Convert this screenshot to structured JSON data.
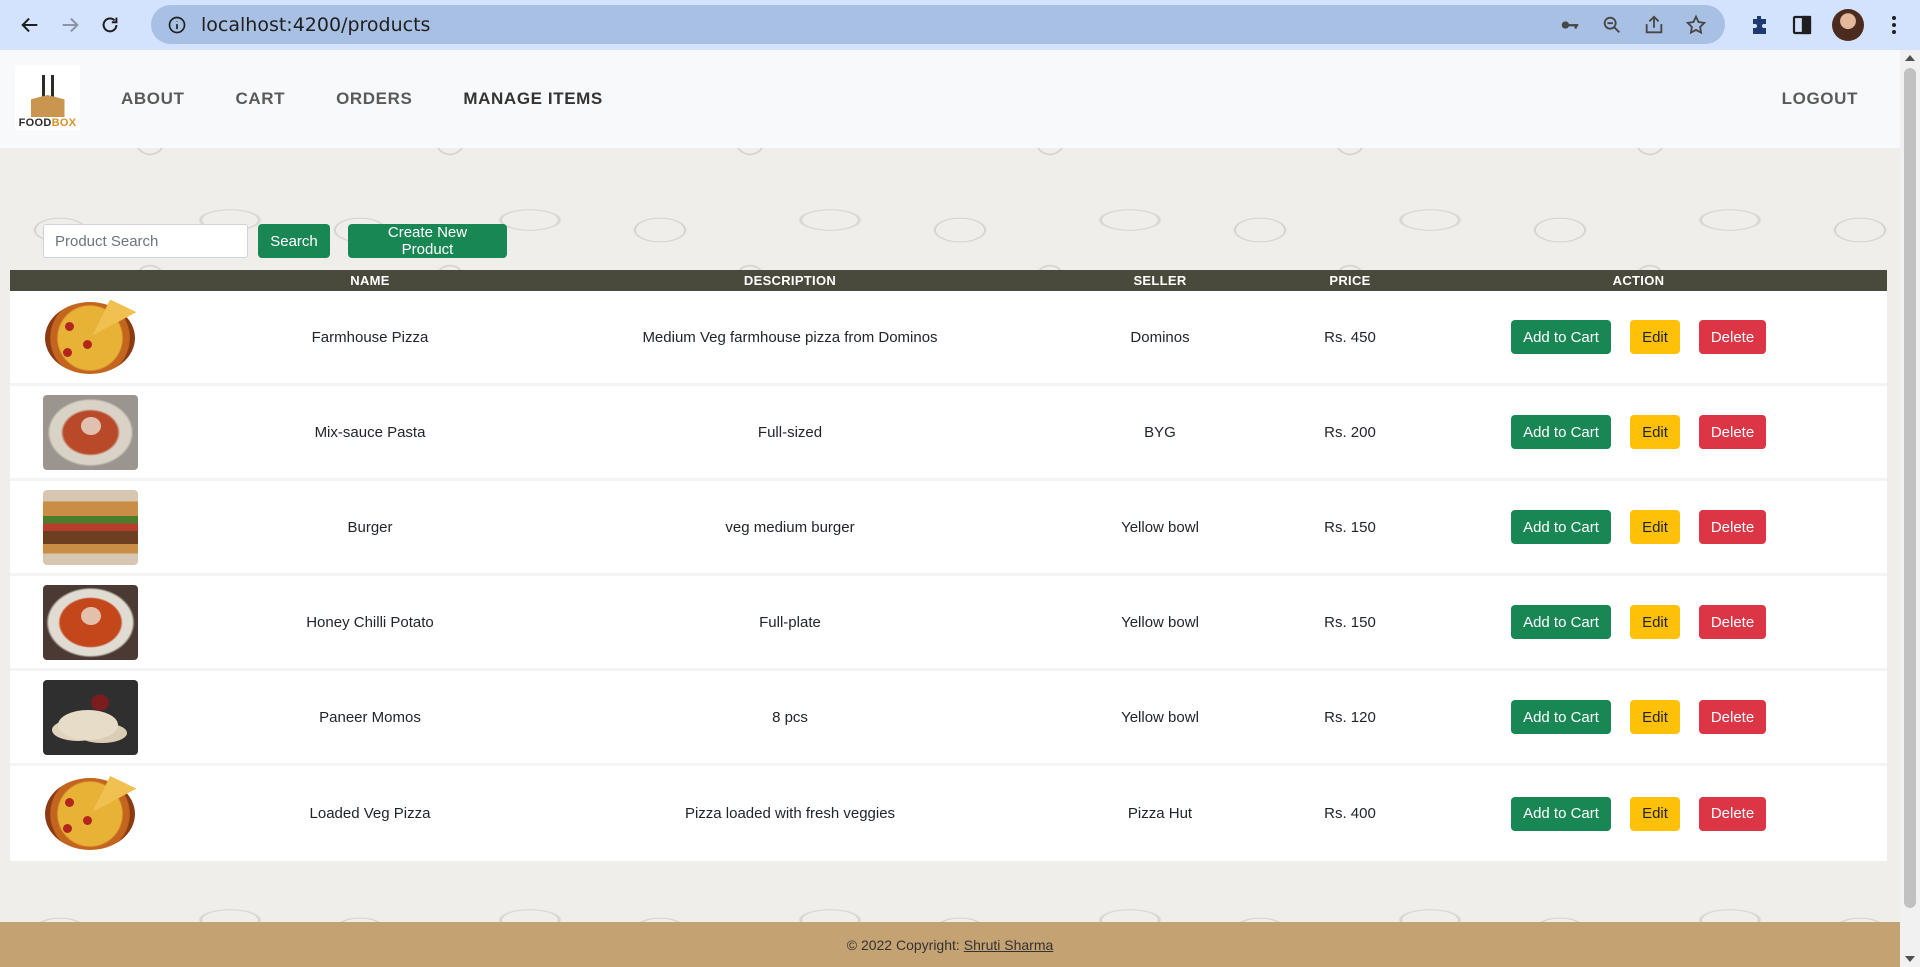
{
  "browser": {
    "url": "localhost:4200/products"
  },
  "brand": {
    "logo_text_1": "FOOD",
    "logo_text_2": "BOX"
  },
  "nav": {
    "items": [
      {
        "label": "ABOUT"
      },
      {
        "label": "CART"
      },
      {
        "label": "ORDERS"
      },
      {
        "label": "MANAGE ITEMS"
      }
    ],
    "logout_label": "LOGOUT"
  },
  "search": {
    "placeholder": "Product Search",
    "search_label": "Search",
    "create_label": "Create New Product"
  },
  "table": {
    "columns": [
      "NAME",
      "DESCRIPTION",
      "SELLER",
      "PRICE",
      "ACTION"
    ],
    "rows": [
      {
        "name": "Farmhouse Pizza",
        "description": "Medium Veg farmhouse pizza from Dominos",
        "seller": "Dominos",
        "price": "Rs. 450",
        "image": "pizza"
      },
      {
        "name": "Mix-sauce Pasta",
        "description": "Full-sized",
        "seller": "BYG",
        "price": "Rs. 200",
        "image": "pasta"
      },
      {
        "name": "Burger",
        "description": "veg medium burger",
        "seller": "Yellow bowl",
        "price": "Rs. 150",
        "image": "burger"
      },
      {
        "name": "Honey Chilli Potato",
        "description": "Full-plate",
        "seller": "Yellow bowl",
        "price": "Rs. 150",
        "image": "honey-chilli-potato"
      },
      {
        "name": "Paneer Momos",
        "description": "8 pcs",
        "seller": "Yellow bowl",
        "price": "Rs. 120",
        "image": "momos"
      },
      {
        "name": "Loaded Veg Pizza",
        "description": "Pizza loaded with fresh veggies",
        "seller": "Pizza Hut",
        "price": "Rs. 400",
        "image": "pizza"
      }
    ],
    "actions": {
      "add_label": "Add to Cart",
      "edit_label": "Edit",
      "delete_label": "Delete"
    }
  },
  "footer": {
    "copyright": "© 2022 Copyright:",
    "author": "Shruti Sharma"
  },
  "colors": {
    "navbar_bg": "#f8f9fa",
    "table_header_bg": "#4a4a3c",
    "footer_bg": "#c5a272",
    "success": "#198754",
    "warning": "#ffc107",
    "danger": "#dc3545"
  }
}
